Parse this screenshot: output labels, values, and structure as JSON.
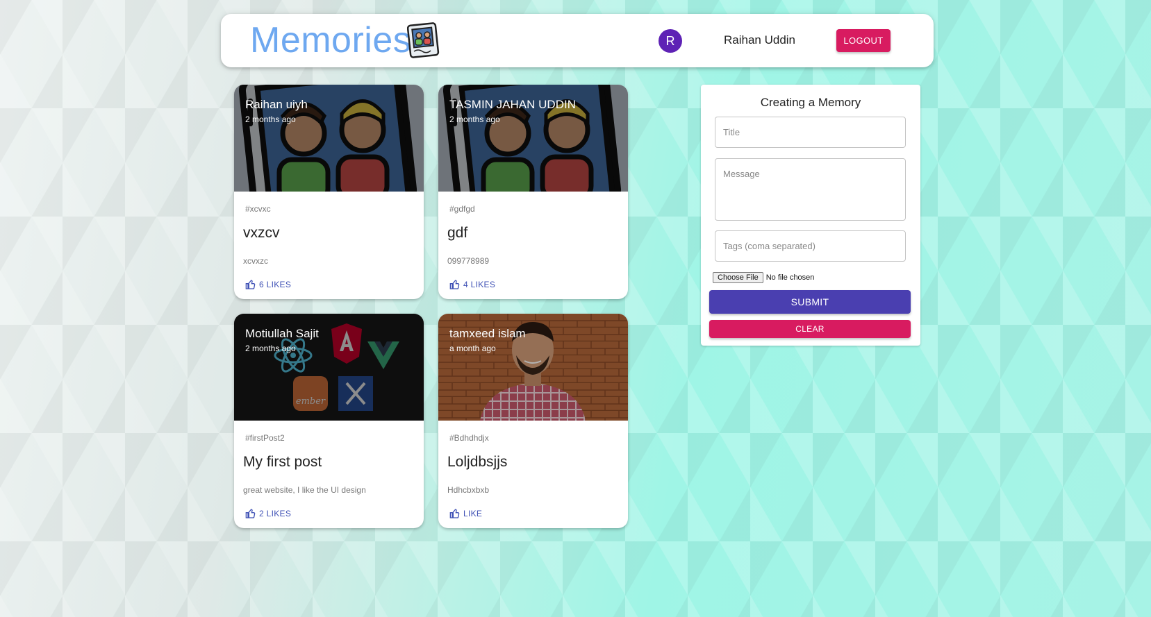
{
  "header": {
    "brand": "Memories",
    "avatar_initial": "R",
    "username": "Raihan Uddin",
    "logout_label": "LOGOUT"
  },
  "posts": [
    {
      "author": "Raihan uiyh",
      "time": "2 months ago",
      "tags": "#xcvxc",
      "title": "vxzcv",
      "message": "xcvxzc",
      "likes": "6 LIKES",
      "image": "memories-icon"
    },
    {
      "author": "TASMIN JAHAN UDDIN",
      "time": "2 months ago",
      "tags": "#gdfgd",
      "title": "gdf",
      "message": "099778989",
      "likes": "4 LIKES",
      "image": "memories-icon"
    },
    {
      "author": "Motiullah Sajit",
      "time": "2 months ago",
      "tags": "#firstPost2",
      "title": "My first post",
      "message": "great website, I like the UI design",
      "likes": "2 LIKES",
      "image": "js-frameworks-logos"
    },
    {
      "author": "tamxeed islam",
      "time": "a month ago",
      "tags": "#Bdhdhdjx",
      "title": "Loljdbsjjs",
      "message": "Hdhcbxbxb",
      "likes": "LIKE",
      "image": "person-photo"
    }
  ],
  "form": {
    "heading": "Creating a Memory",
    "title_placeholder": "Title",
    "message_placeholder": "Message",
    "tags_placeholder": "Tags (coma separated)",
    "file_button": "Choose File",
    "file_status": "No file chosen",
    "submit_label": "SUBMIT",
    "clear_label": "CLEAR"
  },
  "colors": {
    "brand": "#6ea8f0",
    "accent_primary": "#4a3fb0",
    "accent_secondary": "#d81b60",
    "avatar": "#5e22b5",
    "like": "#3f51b5"
  }
}
